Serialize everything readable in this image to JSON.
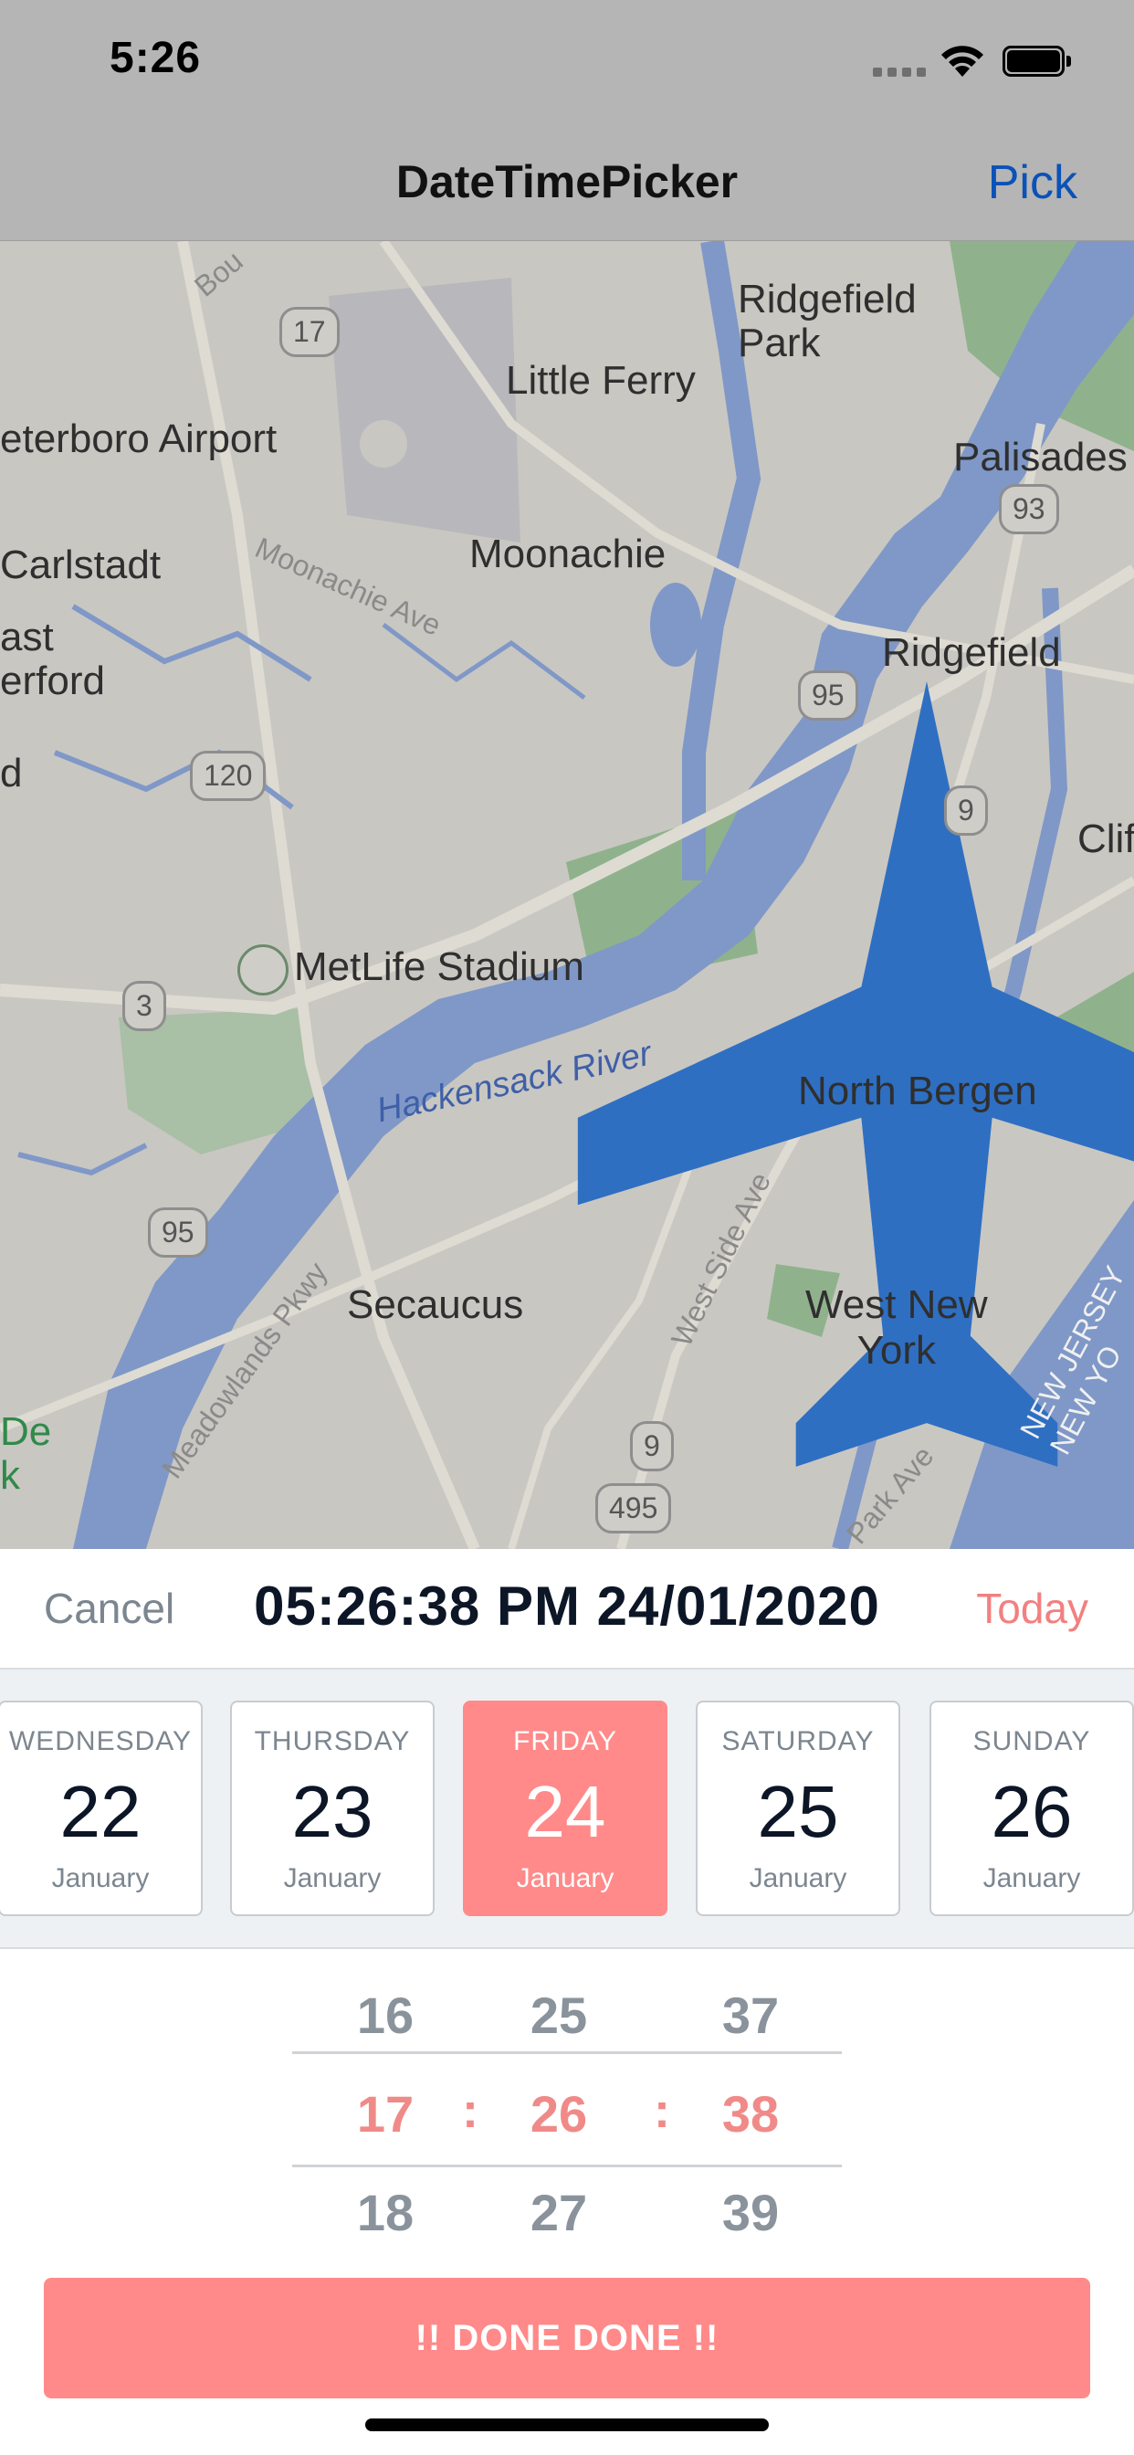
{
  "status_bar": {
    "time": "5:26"
  },
  "nav": {
    "title": "DateTimePicker",
    "pick_label": "Pick"
  },
  "map": {
    "places": {
      "ridgefield_park": "Ridgefield\nPark",
      "little_ferry": "Little Ferry",
      "teterboro_airport": "eterboro Airport",
      "palisades": "Palisades",
      "carlstadt": "Carlstadt",
      "moonachie": "Moonachie",
      "east_rutherford": "ast\nerford",
      "ridgefield": "Ridgefield",
      "cliff": "Clif",
      "metlife_stadium": "MetLife Stadium",
      "north_bergen": "North Bergen",
      "secaucus": "Secaucus",
      "west_new_york": "West New\nYork",
      "de_k": "De\nk",
      "new_jersey": "NEW JERSEY\nNEW YO",
      "d": "d"
    },
    "streets": {
      "moonachie_ave": "Moonachie Ave",
      "hackensack_river": "Hackensack River",
      "meadowlands_pkwy": "Meadowlands Pkwy",
      "west_side_ave": "West Side Ave",
      "park_ave": "Park Ave",
      "bou": "Bou"
    },
    "routes": [
      "17",
      "93",
      "95",
      "120",
      "9",
      "3",
      "95",
      "9",
      "495"
    ]
  },
  "picker": {
    "cancel_label": "Cancel",
    "selected_datetime": "05:26:38 PM 24/01/2020",
    "today_label": "Today",
    "days": [
      {
        "dow": "WEDNESDAY",
        "day": "22",
        "month": "January",
        "selected": false
      },
      {
        "dow": "THURSDAY",
        "day": "23",
        "month": "January",
        "selected": false
      },
      {
        "dow": "FRIDAY",
        "day": "24",
        "month": "January",
        "selected": true
      },
      {
        "dow": "SATURDAY",
        "day": "25",
        "month": "January",
        "selected": false
      },
      {
        "dow": "SUNDAY",
        "day": "26",
        "month": "January",
        "selected": false
      }
    ],
    "time": {
      "hours": [
        "16",
        "17",
        "18"
      ],
      "minutes": [
        "25",
        "26",
        "27"
      ],
      "seconds": [
        "37",
        "38",
        "39"
      ],
      "separator": ":"
    },
    "done_label": "!! DONE DONE !!"
  },
  "colors": {
    "accent": "#ff8a89",
    "today": "#f28080",
    "nav_link": "#0a52b8",
    "dim_overlay": "#b5b5b5"
  }
}
